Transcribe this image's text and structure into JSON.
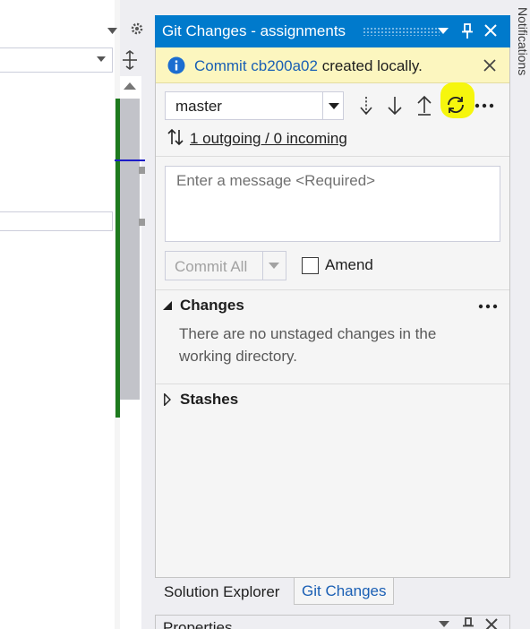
{
  "git_panel": {
    "title": "Git Changes - assignments",
    "info_bar": {
      "link_text": "Commit cb200a02",
      "message": " created locally."
    },
    "branch": "master",
    "outgoing_incoming": "1 outgoing / 0 incoming",
    "message_placeholder": "Enter a message <Required>",
    "commit_button": "Commit All",
    "amend_label": "Amend",
    "amend_checked": false,
    "changes": {
      "title": "Changes",
      "description": "There are no unstaged changes in the working directory."
    },
    "stashes_title": "Stashes"
  },
  "tabs": [
    "Solution Explorer",
    "Git Changes"
  ],
  "active_tab": "Git Changes",
  "right_gutter_label": "Notifications",
  "lower_panel_title": "Properties",
  "colors": {
    "title_bar": "#007acc",
    "info_bar": "#fcf6bf",
    "link": "#1a5fb4",
    "highlight": "#f5f500",
    "git_gutter_marker": "#1e7a1e"
  },
  "icons": {
    "info": "info-icon",
    "fetch": "fetch-icon",
    "pull": "pull-icon",
    "push": "push-icon",
    "sync": "sync-icon",
    "more": "more-icon"
  }
}
